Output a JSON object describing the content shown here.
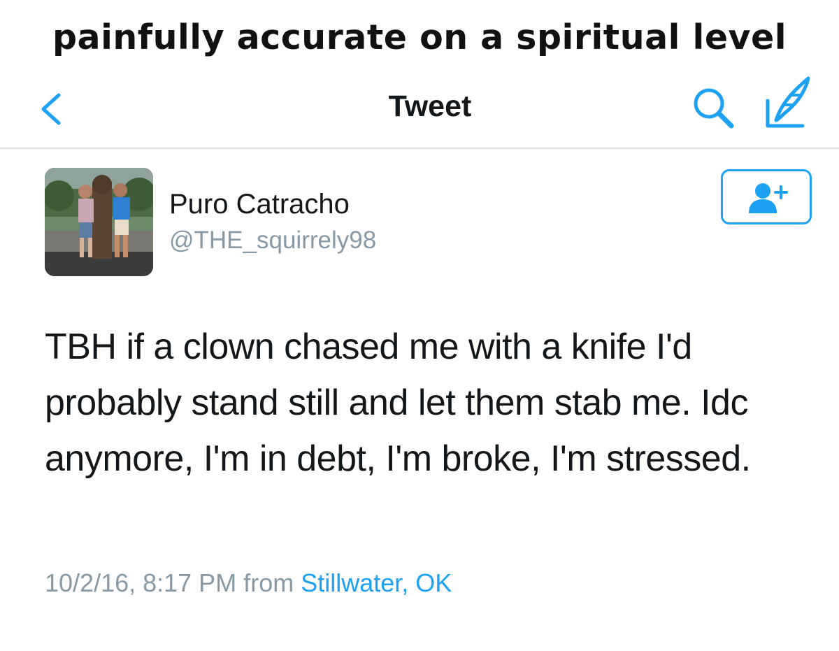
{
  "caption": "painfully accurate on a spiritual level",
  "navbar": {
    "title": "Tweet",
    "back_icon": "chevron-left-icon",
    "search_icon": "search-icon",
    "compose_icon": "compose-icon"
  },
  "tweet": {
    "display_name": "Puro Catracho",
    "handle": "@THE_squirrely98",
    "text": "TBH if a clown chased me with a knife I'd probably stand still and let them stab me. Idc anymore, I'm in debt, I'm broke, I'm stressed.",
    "timestamp": "10/2/16, 8:17 PM",
    "from_label": "from",
    "location": "Stillwater, OK",
    "follow_icon": "add-user-icon"
  },
  "colors": {
    "accent": "#1da1f2",
    "secondary_text": "#8899a6",
    "primary_text": "#14171a",
    "divider": "#dfe3e6"
  }
}
